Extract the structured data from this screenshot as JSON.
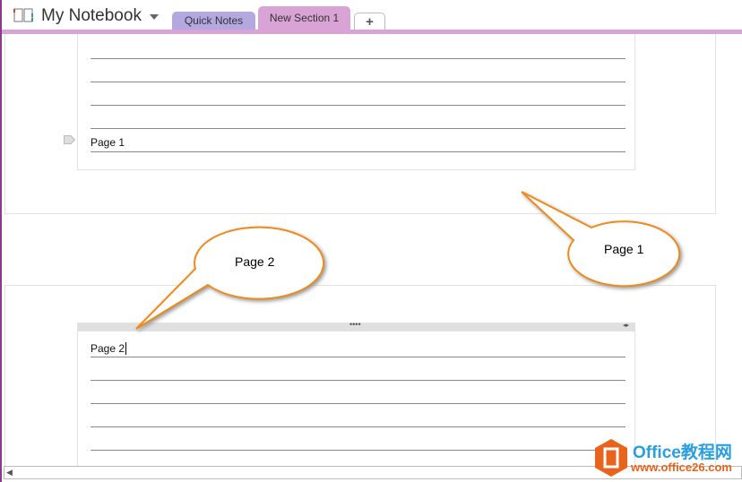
{
  "header": {
    "notebook_title": "My Notebook",
    "tabs": [
      {
        "label": "Quick Notes"
      },
      {
        "label": "New Section 1"
      }
    ],
    "add_tab_label": "+"
  },
  "pages": [
    {
      "note_text": "Page 1"
    },
    {
      "note_text": "Page 2"
    }
  ],
  "callouts": [
    {
      "text": "Page 1"
    },
    {
      "text": "Page 2"
    }
  ],
  "watermark": {
    "brand": "Office教程网",
    "url": "www.office26.com"
  },
  "colors": {
    "accent": "#d9a3d6",
    "callout_stroke": "#f08a1c"
  }
}
